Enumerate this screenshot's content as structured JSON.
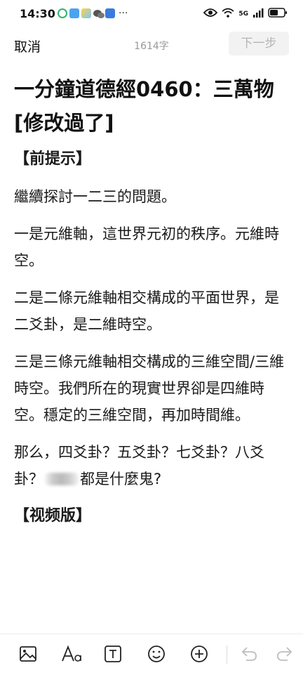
{
  "status_bar": {
    "time": "14:30",
    "more": "···",
    "network": "5G",
    "app_icons": [
      "refresh-app-icon",
      "gallery-app-icon",
      "weather-app-icon",
      "wechat-icon",
      "phone-app-icon"
    ]
  },
  "top_bar": {
    "cancel_label": "取消",
    "word_count": "1614字",
    "next_label": "下一步"
  },
  "article": {
    "title": "一分鐘道德經0460：三萬物[修改過了]",
    "paragraphs": [
      {
        "type": "heading",
        "text": "【前提示】"
      },
      {
        "type": "text",
        "text": "繼續探討一二三的問題。"
      },
      {
        "type": "text",
        "text": "一是元維軸，這世界元初的秩序。元維時空。"
      },
      {
        "type": "text",
        "text": "二是二條元維軸相交構成的平面世界，是二爻卦，是二維時空。"
      },
      {
        "type": "text",
        "text": "三是三條元維軸相交構成的三維空間/三維時空。我們所在的現實世界卻是四維時空。穩定的三維空間，再加時間維。"
      }
    ],
    "last_para_before": "那么，四爻卦？五爻卦？七爻卦？八爻卦？",
    "last_para_after": "都是什麼鬼?",
    "video_heading": "【视频版】"
  },
  "toolbar": {
    "tools": [
      "image-icon",
      "text-format-icon",
      "text-box-icon",
      "emoji-icon",
      "add-icon",
      "undo-icon",
      "redo-icon"
    ]
  },
  "colors": {
    "text": "#1a1a1a",
    "muted": "#999999",
    "disabled_button_bg": "#f2f2f2",
    "disabled_button_text": "#b5b5b5"
  }
}
